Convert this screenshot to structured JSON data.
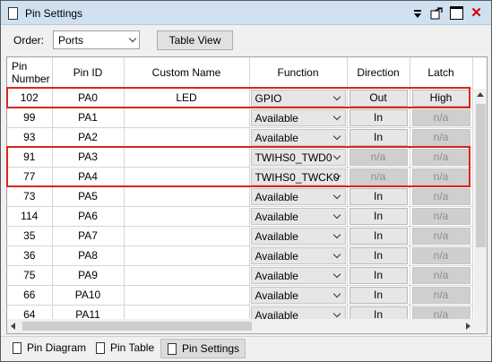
{
  "window": {
    "title": "Pin Settings"
  },
  "toolbar": {
    "order_label": "Order:",
    "order_value": "Ports",
    "table_view_label": "Table View"
  },
  "table": {
    "headers": {
      "pin_number": "Pin\nNumber",
      "pin_id": "Pin ID",
      "custom_name": "Custom Name",
      "function": "Function",
      "direction": "Direction",
      "latch": "Latch"
    },
    "rows": [
      {
        "pin_number": "102",
        "pin_id": "PA0",
        "custom_name": "LED",
        "function": "GPIO",
        "direction": "Out",
        "latch": "High",
        "direction_enabled": true,
        "latch_enabled": true
      },
      {
        "pin_number": "99",
        "pin_id": "PA1",
        "custom_name": "",
        "function": "Available",
        "direction": "In",
        "latch": "n/a",
        "direction_enabled": true,
        "latch_enabled": false
      },
      {
        "pin_number": "93",
        "pin_id": "PA2",
        "custom_name": "",
        "function": "Available",
        "direction": "In",
        "latch": "n/a",
        "direction_enabled": true,
        "latch_enabled": false
      },
      {
        "pin_number": "91",
        "pin_id": "PA3",
        "custom_name": "",
        "function": "TWIHS0_TWD0",
        "direction": "n/a",
        "latch": "n/a",
        "direction_enabled": false,
        "latch_enabled": false
      },
      {
        "pin_number": "77",
        "pin_id": "PA4",
        "custom_name": "",
        "function": "TWIHS0_TWCK0",
        "direction": "n/a",
        "latch": "n/a",
        "direction_enabled": false,
        "latch_enabled": false
      },
      {
        "pin_number": "73",
        "pin_id": "PA5",
        "custom_name": "",
        "function": "Available",
        "direction": "In",
        "latch": "n/a",
        "direction_enabled": true,
        "latch_enabled": false
      },
      {
        "pin_number": "114",
        "pin_id": "PA6",
        "custom_name": "",
        "function": "Available",
        "direction": "In",
        "latch": "n/a",
        "direction_enabled": true,
        "latch_enabled": false
      },
      {
        "pin_number": "35",
        "pin_id": "PA7",
        "custom_name": "",
        "function": "Available",
        "direction": "In",
        "latch": "n/a",
        "direction_enabled": true,
        "latch_enabled": false
      },
      {
        "pin_number": "36",
        "pin_id": "PA8",
        "custom_name": "",
        "function": "Available",
        "direction": "In",
        "latch": "n/a",
        "direction_enabled": true,
        "latch_enabled": false
      },
      {
        "pin_number": "75",
        "pin_id": "PA9",
        "custom_name": "",
        "function": "Available",
        "direction": "In",
        "latch": "n/a",
        "direction_enabled": true,
        "latch_enabled": false
      },
      {
        "pin_number": "66",
        "pin_id": "PA10",
        "custom_name": "",
        "function": "Available",
        "direction": "In",
        "latch": "n/a",
        "direction_enabled": true,
        "latch_enabled": false
      },
      {
        "pin_number": "64",
        "pin_id": "PA11",
        "custom_name": "",
        "function": "Available",
        "direction": "In",
        "latch": "n/a",
        "direction_enabled": true,
        "latch_enabled": false
      }
    ]
  },
  "tabs": [
    {
      "label": "Pin Diagram",
      "active": false
    },
    {
      "label": "Pin Table",
      "active": false
    },
    {
      "label": "Pin Settings",
      "active": true
    }
  ],
  "colors": {
    "highlight": "#d9261c",
    "titlebar": "#cfe0f1"
  }
}
